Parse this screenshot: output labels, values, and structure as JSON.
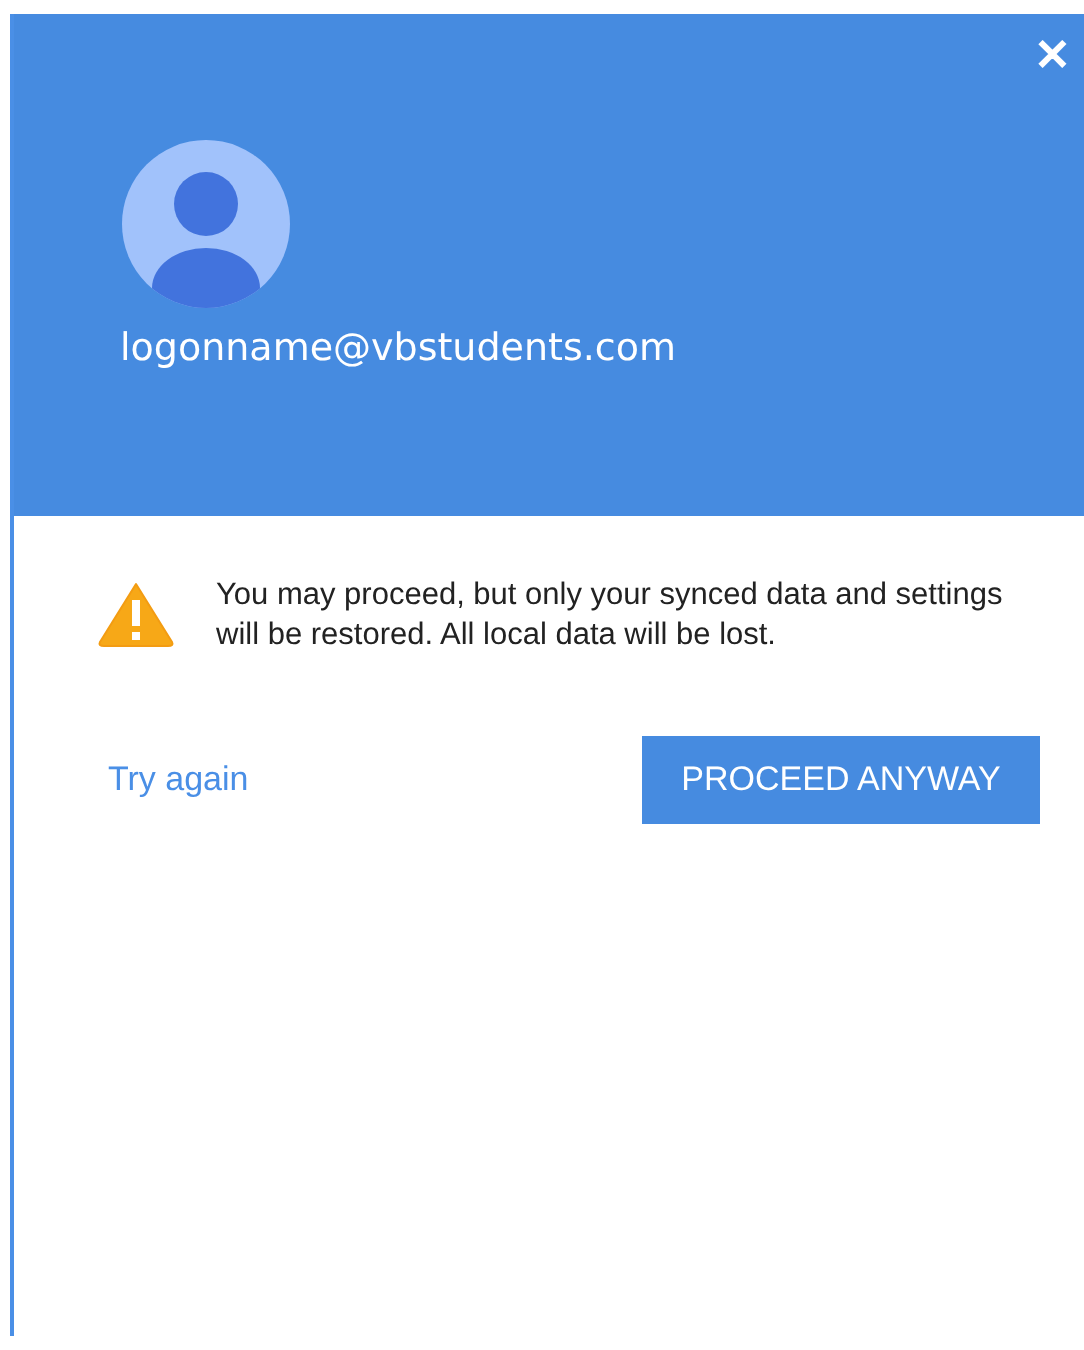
{
  "header": {
    "close": "✕",
    "email": "logonname@vbstudents.com"
  },
  "message": "You may proceed, but only your synced data and settings will be restored. All local data will be lost.",
  "actions": {
    "link": "Try again",
    "button": "PROCEED ANYWAY"
  }
}
